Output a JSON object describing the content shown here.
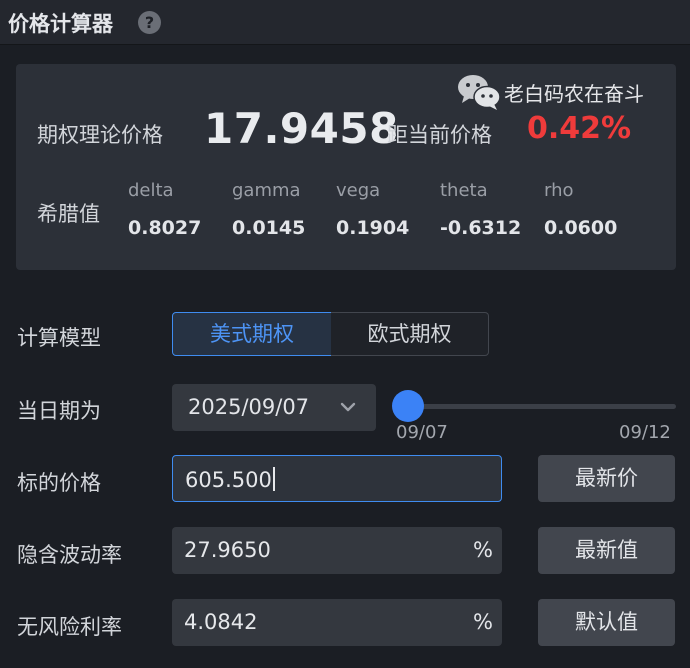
{
  "header": {
    "title": "价格计算器",
    "help_icon": "?"
  },
  "watermark": {
    "text": "老白码农在奋斗"
  },
  "result": {
    "theoretical_price_label": "期权理论价格",
    "theoretical_price": "17.9458",
    "distance_label": "距当前价格",
    "distance_value": "0.42%",
    "greeks_label": "希腊值",
    "greeks": [
      {
        "name": "delta",
        "value": "0.8027"
      },
      {
        "name": "gamma",
        "value": "0.0145"
      },
      {
        "name": "vega",
        "value": "0.1904"
      },
      {
        "name": "theta",
        "value": "-0.6312"
      },
      {
        "name": "rho",
        "value": "0.0600"
      }
    ]
  },
  "form": {
    "model_label": "计算模型",
    "model_options": [
      "美式期权",
      "欧式期权"
    ],
    "model_selected": "美式期权",
    "date_label": "当日期为",
    "date_value": "2025/09/07",
    "slider_start": "09/07",
    "slider_end": "09/12",
    "slider_fraction": 0,
    "underlying_label": "标的价格",
    "underlying_value": "605.500",
    "underlying_button": "最新价",
    "iv_label": "隐含波动率",
    "iv_value": "27.9650",
    "iv_unit": "%",
    "iv_button": "最新值",
    "rate_label": "无风险利率",
    "rate_value": "4.0842",
    "rate_unit": "%",
    "rate_button": "默认值"
  },
  "colors": {
    "accent": "#3f8cf0",
    "negative": "#ef3b3b",
    "background": "#1b1e24",
    "card": "#2c3038"
  }
}
